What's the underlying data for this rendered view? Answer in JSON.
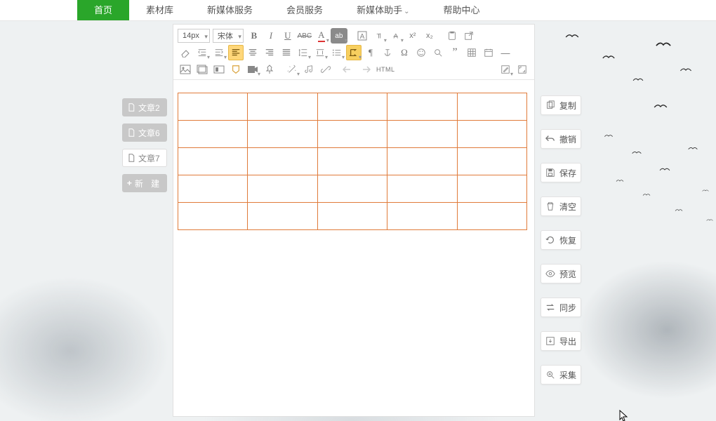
{
  "nav": {
    "items": [
      {
        "label": "首页",
        "active": true
      },
      {
        "label": "素材库"
      },
      {
        "label": "新媒体服务"
      },
      {
        "label": "会员服务"
      },
      {
        "label": "新媒体助手",
        "dropdown": true
      },
      {
        "label": "帮助中心"
      }
    ]
  },
  "doclist": {
    "items": [
      {
        "label": "文章2",
        "muted": true
      },
      {
        "label": "文章6",
        "muted": true
      },
      {
        "label": "文章7",
        "muted": false
      }
    ],
    "new_label": "新 建"
  },
  "toolbar": {
    "font_size": "14px",
    "font_name": "宋体",
    "html_label": "HTML"
  },
  "editor": {
    "table": {
      "rows": 5,
      "cols": 5
    }
  },
  "actions": {
    "items": [
      {
        "icon": "copy",
        "label": "复制"
      },
      {
        "icon": "undo",
        "label": "撤销"
      },
      {
        "icon": "save",
        "label": "保存"
      },
      {
        "icon": "trash",
        "label": "清空"
      },
      {
        "icon": "restore",
        "label": "恢复"
      },
      {
        "icon": "preview",
        "label": "预览"
      },
      {
        "icon": "sync",
        "label": "同步"
      },
      {
        "icon": "export",
        "label": "导出"
      },
      {
        "icon": "collect",
        "label": "采集"
      }
    ]
  }
}
